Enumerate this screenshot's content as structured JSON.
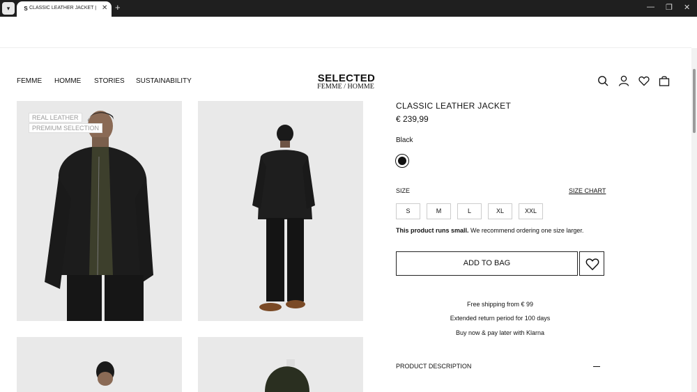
{
  "browser": {
    "tab_title": "CLASSIC LEATHER JACKET | Bla",
    "favicon_letter": "S",
    "close_glyph": "✕",
    "new_tab_glyph": "+",
    "minimize_glyph": "—",
    "restore_glyph": "❐",
    "window_close_glyph": "✕"
  },
  "nav": {
    "items": [
      "FEMME",
      "HOMME",
      "STORIES",
      "SUSTAINABILITY"
    ]
  },
  "brand": {
    "name": "SELECTED",
    "sub": "FEMME / HOMME"
  },
  "header_icons": [
    "search-icon",
    "account-icon",
    "wishlist-icon",
    "bag-icon"
  ],
  "gallery": {
    "badges": [
      "REAL LEATHER",
      "PREMIUM SELECTION"
    ]
  },
  "product": {
    "title": "CLASSIC LEATHER JACKET",
    "price": "€ 239,99",
    "color_name": "Black",
    "swatch_color": "#111111",
    "size_label": "SIZE",
    "size_chart": "SIZE CHART",
    "sizes": [
      "S",
      "M",
      "L",
      "XL",
      "XXL"
    ],
    "note_bold": "This product runs small.",
    "note_rest": " We recommend ordering one size larger.",
    "add_to_bag": "ADD TO BAG",
    "shipping": "Free shipping from € 99",
    "returns": "Extended return period for 100 days",
    "klarna": "Buy now & pay later with Klarna",
    "description_label": "PRODUCT DESCRIPTION"
  }
}
